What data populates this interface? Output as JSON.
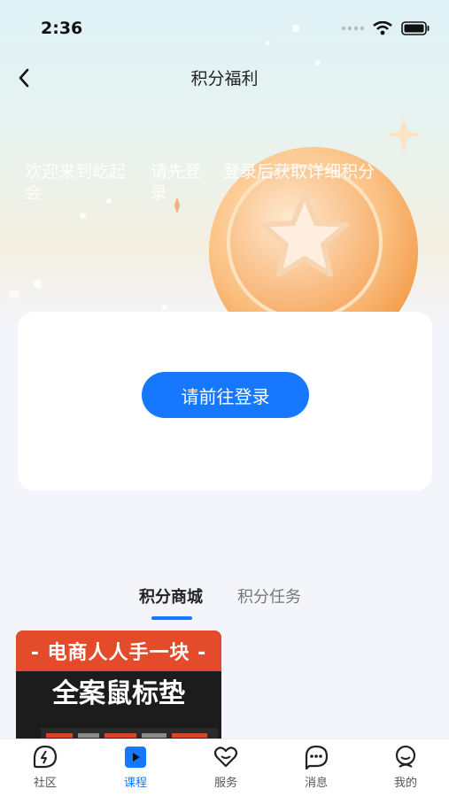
{
  "status": {
    "time": "2:36"
  },
  "nav": {
    "title": "积分福利"
  },
  "hero": {
    "texts": [
      "欢迎来到屹起会",
      "请先登录",
      "登录后获取详细积分"
    ]
  },
  "card": {
    "login_button": "请前往登录"
  },
  "tabs": [
    {
      "label": "积分商城"
    },
    {
      "label": "积分任务"
    }
  ],
  "product": {
    "tagline": "- 电商人人手一块 -",
    "headline": "全案鼠标垫"
  },
  "tabbar": [
    {
      "label": "社区"
    },
    {
      "label": "课程"
    },
    {
      "label": "服务"
    },
    {
      "label": "消息"
    },
    {
      "label": "我的"
    }
  ],
  "colors": {
    "accent": "#1677ff",
    "coin": "#f7a65a"
  }
}
